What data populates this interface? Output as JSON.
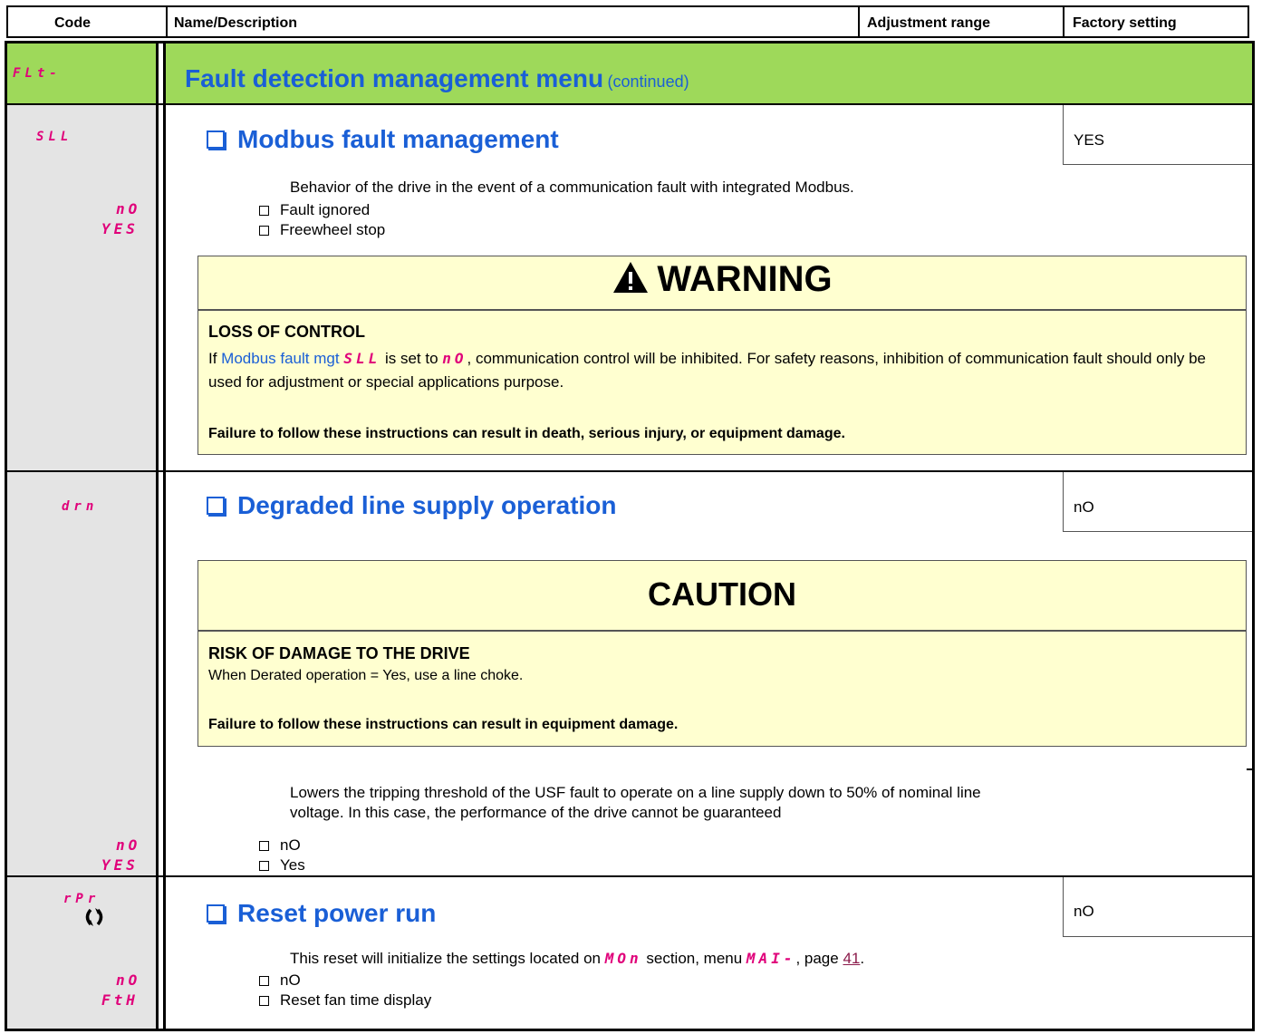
{
  "header": {
    "code": "Code",
    "name": "Name/Description",
    "range": "Adjustment range",
    "factory": "Factory setting"
  },
  "menu": {
    "code": "FLt-",
    "title": "Fault detection management menu",
    "continued": "(continued)"
  },
  "sll": {
    "code": "SLL",
    "title": "Modbus fault management",
    "factory": "YES",
    "desc": "Behavior of the drive in the event of a communication fault with integrated Modbus.",
    "options": [
      {
        "code": "nO",
        "label": "Fault ignored"
      },
      {
        "code": "YES",
        "label": "Freewheel stop"
      }
    ],
    "warning": {
      "heading": "WARNING",
      "subtitle": "LOSS OF CONTROL",
      "text_pre": "If ",
      "param_link": "Modbus fault mgt",
      "param_code": "SLL",
      "text_mid": " is set to ",
      "value_code": "nO",
      "text_post": ", communication control will be inhibited. For safety reasons, inhibition of communication fault should only be used for adjustment or special applications purpose.",
      "footer": "Failure to follow these instructions can result in death, serious injury, or equipment damage."
    }
  },
  "drn": {
    "code": "drn",
    "title": "Degraded line supply operation",
    "factory": "nO",
    "caution": {
      "heading": "CAUTION",
      "subtitle": "RISK OF DAMAGE TO THE DRIVE",
      "text": "When Derated operation = Yes, use a line choke.",
      "footer": "Failure to follow these instructions can result in equipment damage."
    },
    "desc_line1": "Lowers the tripping threshold of the USF fault to operate on a line supply down to 50% of nominal line",
    "desc_line2": "voltage. In this case, the performance of the drive cannot be guaranteed",
    "options": [
      {
        "code": "nO",
        "label": "nO"
      },
      {
        "code": "YES",
        "label": "Yes"
      }
    ]
  },
  "rpr": {
    "code": "rPr",
    "title": "Reset power run",
    "factory": "nO",
    "desc_pre": "This reset will initialize the settings located on ",
    "section_code": "MOn",
    "desc_mid": " section, menu ",
    "menu_code": "MAI-",
    "desc_mid2": ", page ",
    "page": "41",
    "desc_post": ".",
    "options": [
      {
        "code": "nO",
        "label": "nO"
      },
      {
        "code": "FtH",
        "label": "Reset fan time display"
      }
    ]
  },
  "colors": {
    "code_column_bg": "#e4e4e4",
    "menu_bar_bg": "#9ed95a",
    "notice_bg": "#ffffd0",
    "title_blue": "#1a5fd6",
    "code_magenta": "#e0007a"
  }
}
